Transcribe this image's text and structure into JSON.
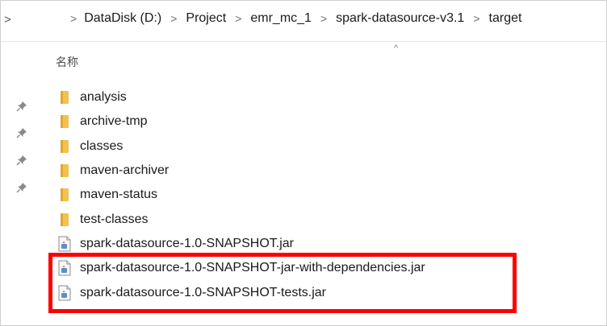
{
  "address_bar": {
    "breadcrumbs": [
      "DataDisk (D:)",
      "Project",
      "emr_mc_1",
      "spark-datasource-v3.1",
      "target"
    ]
  },
  "column_header": {
    "name_label": "名称"
  },
  "files": [
    {
      "name": "analysis",
      "type": "folder",
      "icon": "folder-icon"
    },
    {
      "name": "archive-tmp",
      "type": "folder",
      "icon": "folder-icon"
    },
    {
      "name": "classes",
      "type": "folder",
      "icon": "folder-icon"
    },
    {
      "name": "maven-archiver",
      "type": "folder",
      "icon": "folder-icon"
    },
    {
      "name": "maven-status",
      "type": "folder",
      "icon": "folder-icon"
    },
    {
      "name": "test-classes",
      "type": "folder",
      "icon": "folder-icon"
    },
    {
      "name": "spark-datasource-1.0-SNAPSHOT.jar",
      "type": "jar",
      "icon": "jar-file-icon"
    },
    {
      "name": "spark-datasource-1.0-SNAPSHOT-jar-with-dependencies.jar",
      "type": "jar",
      "icon": "jar-file-icon"
    },
    {
      "name": "spark-datasource-1.0-SNAPSHOT-tests.jar",
      "type": "jar",
      "icon": "jar-file-icon"
    }
  ],
  "colors": {
    "highlight": "#ff0000",
    "folder": "#f2c14e",
    "folder_dark": "#e0a82e"
  }
}
